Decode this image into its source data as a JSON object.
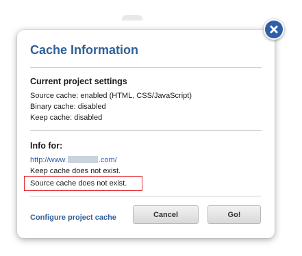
{
  "dialog": {
    "title": "Cache Information",
    "close_icon": "close-icon",
    "current_settings": {
      "heading": "Current project settings",
      "lines": [
        "Source cache: enabled (HTML, CSS/JavaScript)",
        "Binary cache: disabled",
        "Keep cache: disabled"
      ]
    },
    "info": {
      "heading": "Info for:",
      "url_prefix": "http://www.",
      "url_suffix": ".com/",
      "keep_cache_status": "Keep cache does not exist.",
      "source_cache_status": "Source cache does not exist."
    },
    "footer": {
      "configure_link": "Configure project cache",
      "cancel_label": "Cancel",
      "go_label": "Go!"
    }
  },
  "colors": {
    "accent": "#2f5f97",
    "link": "#2a5db0",
    "highlight": "#e0242a"
  }
}
